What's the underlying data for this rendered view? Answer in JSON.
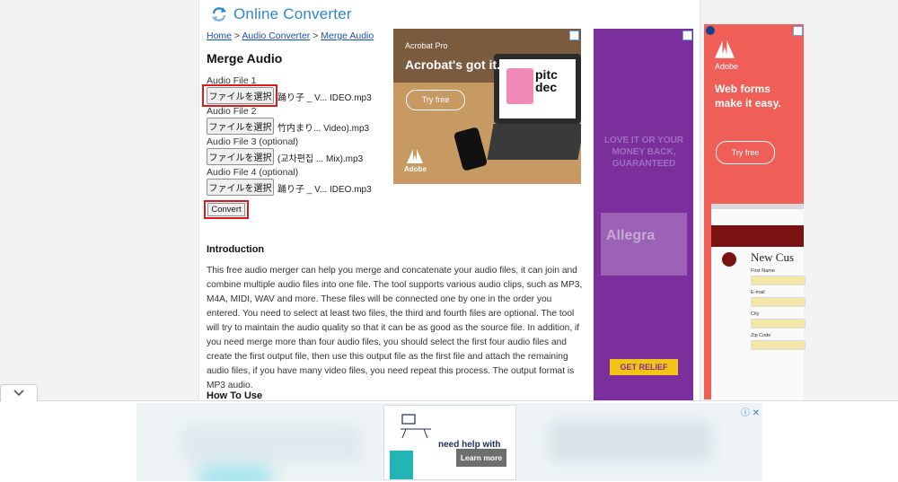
{
  "site": {
    "name": "Online Converter"
  },
  "breadcrumb": {
    "home": "Home",
    "sep": " > ",
    "audio_converter": "Audio Converter",
    "current": "Merge Audio"
  },
  "page": {
    "title": "Merge Audio"
  },
  "files": [
    {
      "label": "Audio File 1",
      "button": "ファイルを選択",
      "filename": "踊り子 _ V... IDEO.mp3"
    },
    {
      "label": "Audio File 2",
      "button": "ファイルを選択",
      "filename": "竹内まり... Video).mp3"
    },
    {
      "label": "Audio File 3 (optional)",
      "button": "ファイルを選択",
      "filename": "(교차편집 ... Mix).mp3"
    },
    {
      "label": "Audio File 4 (optional)",
      "button": "ファイルを選択",
      "filename": "踊り子 _ V... IDEO.mp3"
    }
  ],
  "convert": {
    "label": "Convert"
  },
  "intro": {
    "title": "Introduction",
    "text": "This free audio merger can help you merge and concatenate your audio files, it can join and combine multiple audio files into one file. The tool supports various audio clips, such as MP3, M4A, MIDI, WAV and more. These files will be connected one by one in the order you entered. You need to select at least two files, the third and fourth files are optional. The tool will try to maintain the audio quality so that it can be as good as the source file. In addition, if you need merge more than four audio files, you should select the first four audio files and create the first output file, then use this output file as the first file and attach the remaining audio files, if you have many video files, you need repeat this process. The output format is MP3 audio."
  },
  "howto": {
    "title": "How To Use"
  },
  "ads": {
    "acrobat": {
      "brand": "Acrobat Pro",
      "headline": "Acrobat's got it.",
      "cta": "Try free",
      "pitch": "pitc\ndec",
      "adobe": "Adobe"
    },
    "allegra": {
      "tagline": "LOVE IT OR YOUR MONEY BACK, GUARANTEED",
      "product": "Allegra",
      "cta": "GET RELIEF"
    },
    "adobe_forms": {
      "brand": "Adobe",
      "headline": "Web forms make it easy.",
      "cta": "Try free",
      "form_title": "New Cus",
      "fields": [
        "First Name",
        "E-mail",
        "City",
        "Zip Code"
      ]
    },
    "bottom": {
      "question": "need help with",
      "cta": "Learn more",
      "close": "ⓘ ✕"
    }
  },
  "colors": {
    "link": "#1a4fb8",
    "logo": "#2f86d4",
    "highlight": "#e01818"
  }
}
